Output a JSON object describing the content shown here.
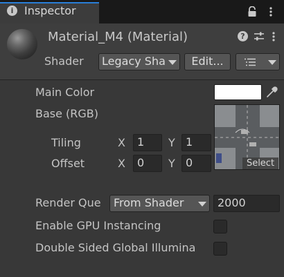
{
  "tab": {
    "label": "Inspector"
  },
  "header": {
    "title": "Material_M4 (Material)",
    "shader_label": "Shader",
    "shader_value": "Legacy Shaders/Diffuse",
    "edit_label": "Edit..."
  },
  "properties": {
    "main_color_label": "Main Color",
    "main_color_value": "#ffffff",
    "base_label": "Base (RGB)",
    "texture_select_label": "Select",
    "tiling_label": "Tiling",
    "tiling_x": "1",
    "tiling_y": "1",
    "offset_label": "Offset",
    "offset_x": "0",
    "offset_y": "0",
    "x_axis": "X",
    "y_axis": "Y",
    "render_queue_label": "Render Que",
    "render_queue_mode": "From Shader",
    "render_queue_value": "2000",
    "gpu_instancing_label": "Enable GPU Instancing",
    "gpu_instancing_checked": false,
    "double_sided_gi_label": "Double Sided Global Illumina",
    "double_sided_gi_checked": false
  },
  "icons": {
    "tab": "info-icon",
    "lock": "lock-icon",
    "menu": "kebab-menu-icon",
    "help": "help-icon",
    "preset": "preset-sliders-icon",
    "more": "more-options-icon",
    "picker": "eyedropper-icon"
  },
  "colors": {
    "accent": "#2a7fd8",
    "background": "#383838",
    "header": "#3e3e3e"
  }
}
